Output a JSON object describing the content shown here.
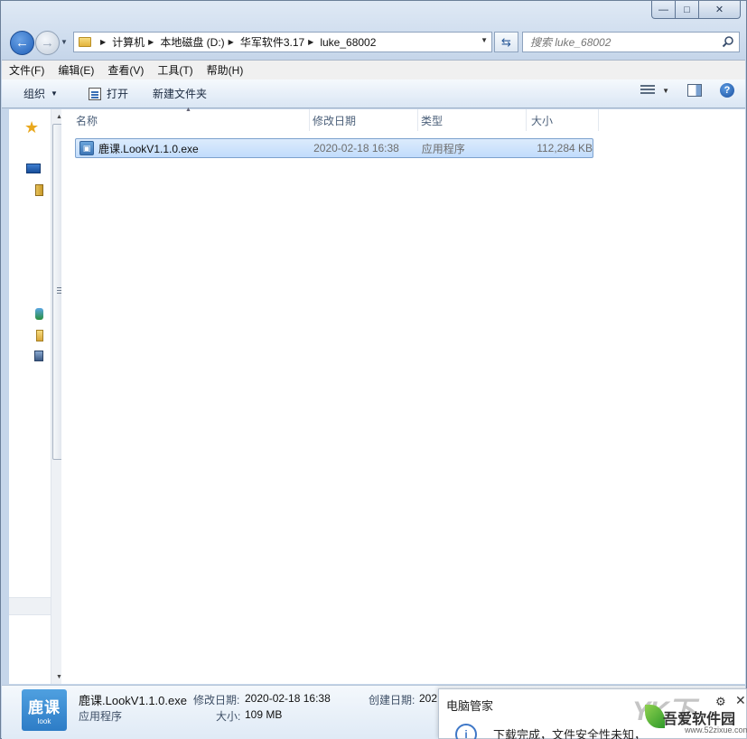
{
  "window": {
    "controls": {
      "minimize": "—",
      "maximize": "□",
      "close": "✕"
    }
  },
  "nav": {
    "breadcrumbs": [
      "计算机",
      "本地磁盘 (D:)",
      "华军软件3.17",
      "luke_68002"
    ],
    "search_placeholder": "搜索 luke_68002"
  },
  "menubar": [
    "文件(F)",
    "编辑(E)",
    "查看(V)",
    "工具(T)",
    "帮助(H)"
  ],
  "toolbar": {
    "organize": "组织",
    "open": "打开",
    "new_folder": "新建文件夹",
    "help": "?"
  },
  "filelist": {
    "columns": [
      "名称",
      "修改日期",
      "类型",
      "大小"
    ],
    "rows": [
      {
        "name": "鹿课.LookV1.1.0.exe",
        "modified": "2020-02-18 16:38",
        "type": "应用程序",
        "size": "112,284 KB"
      }
    ]
  },
  "details": {
    "thumb_text": "鹿课",
    "thumb_sub": "look",
    "name": "鹿课.LookV1.1.0.exe",
    "type": "应用程序",
    "modified_label": "修改日期:",
    "modified_value": "2020-02-18 16:38",
    "size_label": "大小:",
    "size_value": "109 MB",
    "created_label": "创建日期:",
    "created_value": "202"
  },
  "popup": {
    "title": "电脑管家",
    "message": "下载完成，文件安全性未知，",
    "info_glyph": "i"
  },
  "watermark": {
    "big": "YK下",
    "brand": "吾爱软件园",
    "url": "www.52zixue.com"
  }
}
